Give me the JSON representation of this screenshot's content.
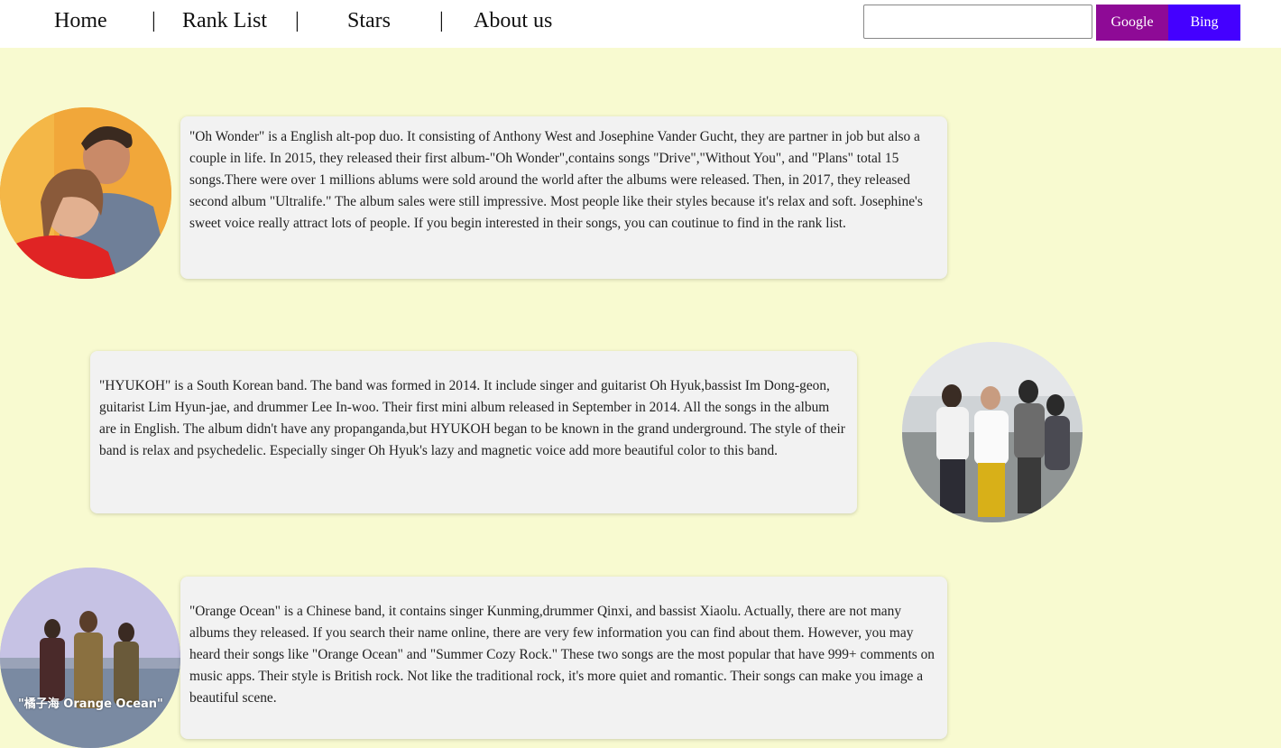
{
  "nav": {
    "home": "Home",
    "rank_list": "Rank List",
    "stars": "Stars",
    "about_us": "About us",
    "separator": "|"
  },
  "search": {
    "value": "",
    "google_label": "Google",
    "bing_label": "Bing"
  },
  "colors": {
    "background": "#f8fad0",
    "card_background": "#f2f2f2",
    "google_button": "#8e0a96",
    "bing_button": "#4400ff"
  },
  "bands": [
    {
      "text": "\"Oh Wonder\" is a English alt-pop duo. It consisting of Anthony West and Josephine Vander Gucht, they are partner in job but also a couple in life. In 2015, they released their first album-\"Oh Wonder\",contains songs \"Drive\",\"Without You\", and \"Plans\" total 15 songs.There were over 1 millions ablums were sold around the world after the albums were released. Then, in 2017, they released second album \"Ultralife.\" The album sales were still impressive. Most people like their styles because it's relax and soft. Josephine's sweet voice really attract lots of people. If you begin interested in their songs, you can coutinue to find in the rank list."
    },
    {
      "text": "\"HYUKOH\" is a South Korean band. The band was formed in 2014. It include singer and guitarist Oh Hyuk,bassist Im Dong-geon, guitarist Lim Hyun-jae, and drummer Lee In-woo. Their first mini album released in September in 2014. All the songs in the album are in English. The album didn't have any propanganda,but HYUKOH began to be known in the grand underground. The style of their band is relax and psychedelic. Especially singer Oh Hyuk's lazy and magnetic voice add more beautiful color to this band."
    },
    {
      "text": "\"Orange Ocean\" is a Chinese band, it contains singer Kunming,drummer Qinxi, and bassist Xiaolu. Actually, there are not many albums they released. If you search their name online, there are very few information you can find about them. However, you may heard their songs like \"Orange Ocean\" and \"Summer Cozy Rock.\" These two songs are the most popular that have 999+ comments on music apps. Their style is British rock. Not like the traditional rock, it's more quiet and romantic. Their songs can make you image a beautiful scene.",
      "image_caption": "\"橘子海 Orange Ocean\""
    }
  ]
}
